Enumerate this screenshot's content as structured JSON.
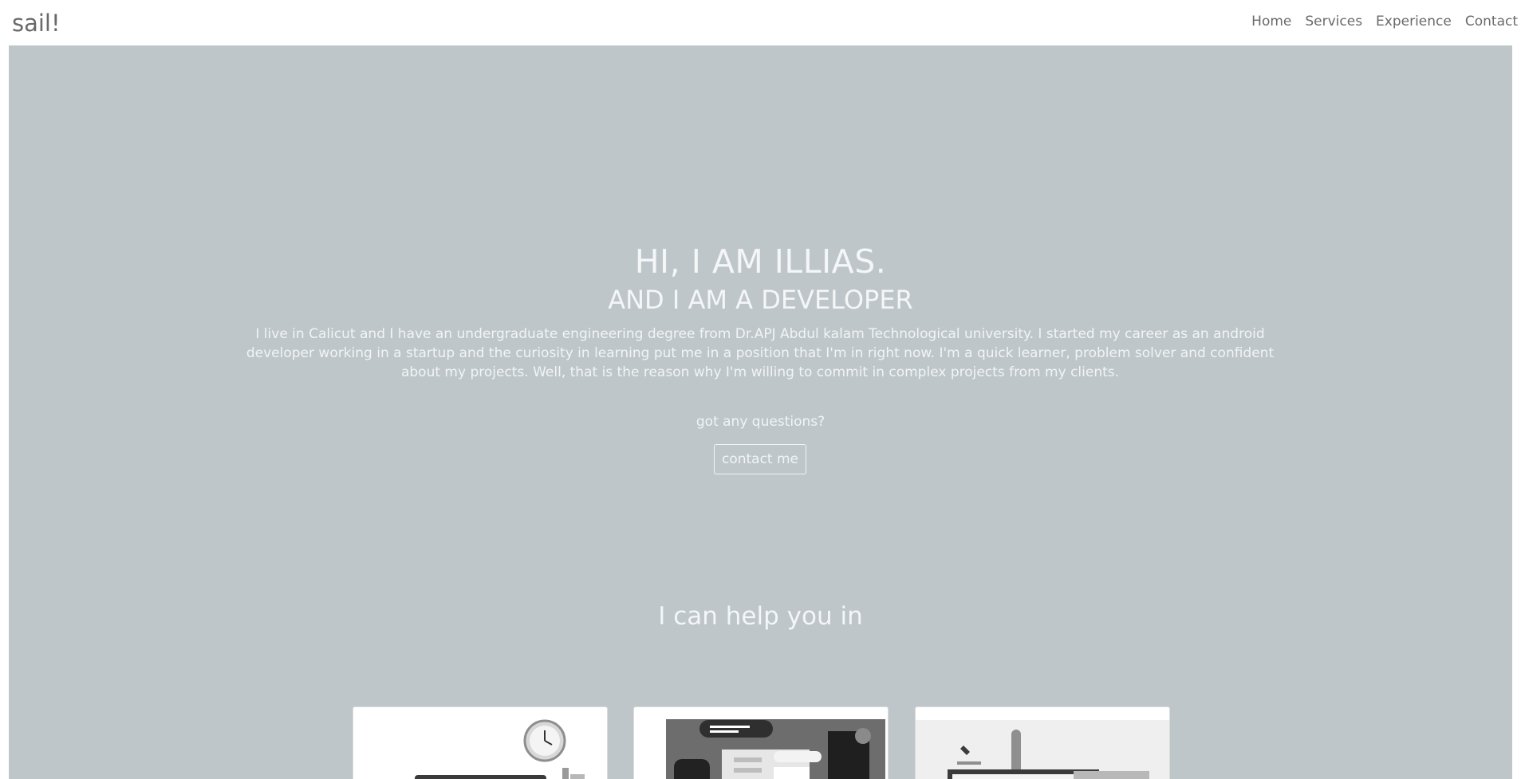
{
  "brand": "sail!",
  "nav": {
    "items": [
      {
        "label": "Home"
      },
      {
        "label": "Services"
      },
      {
        "label": "Experience"
      },
      {
        "label": "Contact"
      }
    ]
  },
  "hero": {
    "title": "HI, I AM ILLIAS.",
    "subtitle": "AND I AM A DEVELOPER",
    "intro": "I live in Calicut and I have an undergraduate engineering degree from Dr.APJ Abdul kalam Technological university. I started my career as an android developer working in a startup and the curiosity in learning put me in a position that I'm in right now. I'm a quick learner, problem solver and confident about my projects. Well, that is the reason why I'm willing to commit in complex projects from my clients.",
    "questions": "got any questions?",
    "contact_label": "contact me"
  },
  "services": {
    "heading": "I can help you in",
    "cards": [
      {
        "icon": "clock-laptop-illustration"
      },
      {
        "icon": "web-development-illustration"
      },
      {
        "icon": "design-tools-illustration"
      }
    ]
  },
  "colors": {
    "hero_background": "#bec6c9",
    "hero_text": "#f2f4f5",
    "nav_text": "#6a6a6a"
  }
}
